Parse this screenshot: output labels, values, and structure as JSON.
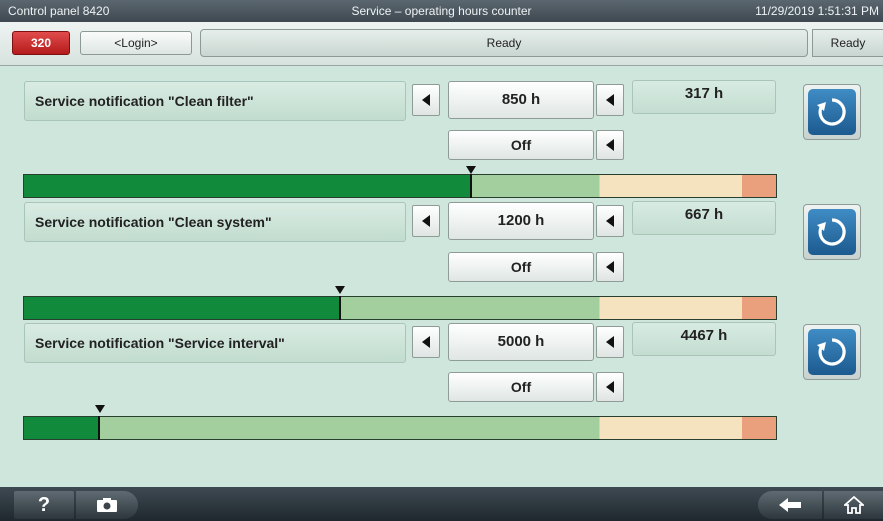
{
  "titlebar": {
    "panel": "Control panel 8420",
    "screen": "Service – operating hours counter",
    "datetime": "11/29/2019 1:51:31 PM"
  },
  "statusbar": {
    "error_count": "320",
    "login_label": "<Login>",
    "status_text": "Ready",
    "status_right": "Ready"
  },
  "notifications": [
    {
      "label": "Service notification \"Clean filter\"",
      "interval": "850 h",
      "mode": "Off",
      "remaining": "317 h",
      "progress_fraction": 0.594
    },
    {
      "label": "Service notification \"Clean system\"",
      "interval": "1200 h",
      "mode": "Off",
      "remaining": "667 h",
      "progress_fraction": 0.42
    },
    {
      "label": "Service notification \"Service interval\"",
      "interval": "5000 h",
      "mode": "Off",
      "remaining": "4467 h",
      "progress_fraction": 0.1
    }
  ],
  "icons": {
    "decrease": "arrow-left-icon",
    "reset": "reset-icon",
    "help": "help-icon",
    "camera": "camera-icon",
    "back": "back-arrow-icon",
    "home": "home-icon"
  },
  "colors": {
    "elapsed": "#128a3b",
    "ok": "#a3cf9f",
    "warning": "#f5e3c0",
    "alarm": "#eaa07d",
    "reset_button": "#2a6fa8"
  },
  "bottombar": {
    "help_label": "?"
  }
}
